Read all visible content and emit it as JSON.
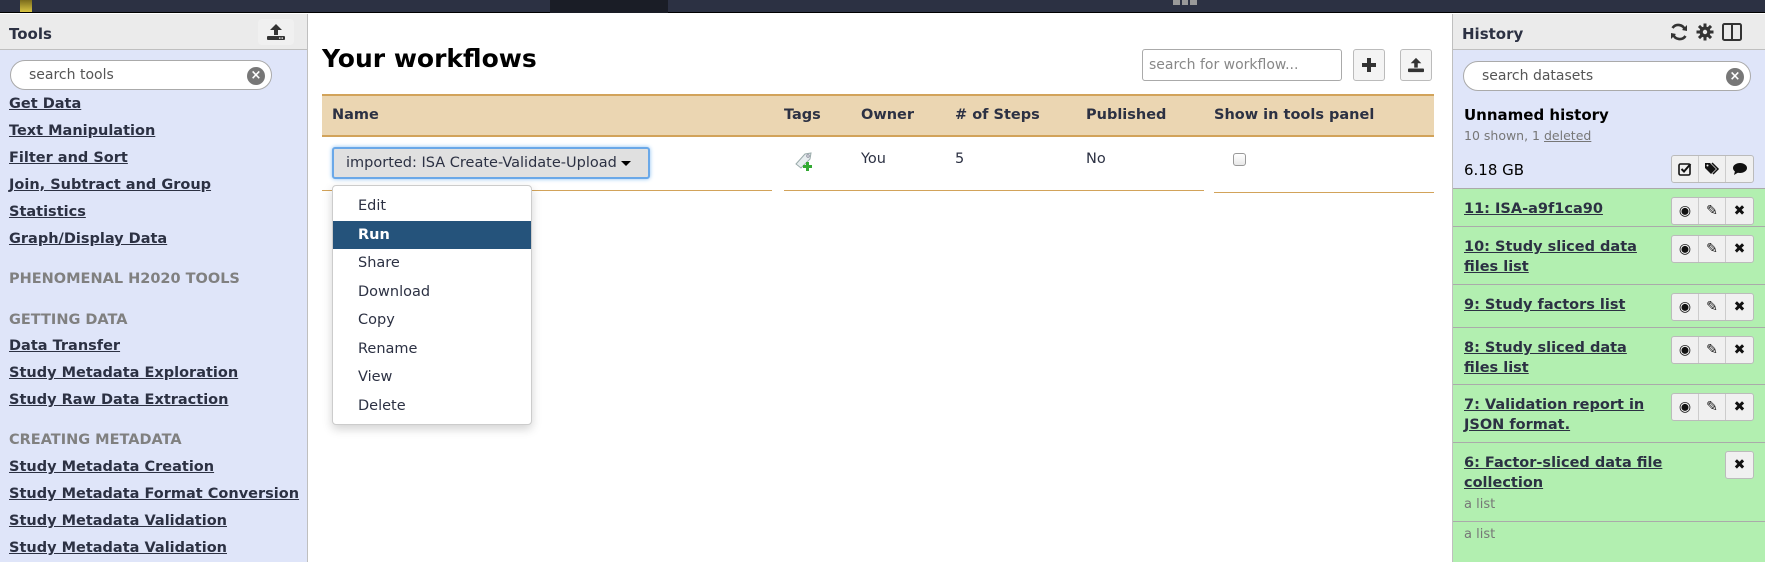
{
  "tool_panel": {
    "title": "Tools",
    "search_placeholder": "search tools",
    "links": [
      "Get Data",
      "Text Manipulation",
      "Filter and Sort",
      "Join, Subtract and Group",
      "Statistics",
      "Graph/Display Data"
    ],
    "sections": [
      {
        "label": "PHENOMENAL H2020 TOOLS",
        "items": []
      },
      {
        "label": "GETTING DATA",
        "items": [
          "Data Transfer",
          "Study Metadata Exploration",
          "Study Raw Data Extraction"
        ]
      },
      {
        "label": "CREATING METADATA",
        "items": [
          "Study Metadata Creation",
          "Study Metadata Format Conversion",
          "Study Metadata Validation",
          "Study Metadata Validation"
        ]
      }
    ]
  },
  "workflows": {
    "title": "Your workflows",
    "search_placeholder": "search for workflow...",
    "create_icon": "plus-icon",
    "import_icon": "upload-icon",
    "columns": [
      "Name",
      "Tags",
      "Owner",
      "# of Steps",
      "Published",
      "Show in tools panel"
    ],
    "rows": [
      {
        "name": "imported: ISA Create-Validate-Upload",
        "tags_icon": "add-tag-icon",
        "owner": "You",
        "steps": "5",
        "published": "No",
        "show_in_tools": false
      }
    ],
    "menu": {
      "items": [
        "Edit",
        "Run",
        "Share",
        "Download",
        "Copy",
        "Rename",
        "View",
        "Delete"
      ],
      "active": "Run"
    }
  },
  "history": {
    "title": "History",
    "header_icons": [
      "refresh-icon",
      "gear-icon",
      "columns-icon"
    ],
    "search_placeholder": "search datasets",
    "name": "Unnamed history",
    "shown": "10 shown, 1",
    "deleted_link": "deleted",
    "size": "6.18 GB",
    "action_icons": [
      "select-icon",
      "tags-icon",
      "comment-icon"
    ],
    "datasets": [
      {
        "title": "11: ISA-a9f1ca90 ",
        "state": "ok",
        "buttons": [
          "eye-icon",
          "pencil-icon",
          "delete-icon"
        ]
      },
      {
        "title": "10: Study sliced data files list ",
        "state": "ok",
        "buttons": [
          "eye-icon",
          "pencil-icon",
          "delete-icon"
        ]
      },
      {
        "title": "9: Study factors list ",
        "state": "ok",
        "buttons": [
          "eye-icon",
          "pencil-icon",
          "delete-icon"
        ]
      },
      {
        "title": "8: Study sliced data files list ",
        "state": "ok",
        "buttons": [
          "eye-icon",
          "pencil-icon",
          "delete-icon"
        ]
      },
      {
        "title": "7: Validation report in JSON format. ",
        "state": "ok",
        "buttons": [
          "eye-icon",
          "pencil-icon",
          "delete-icon"
        ]
      },
      {
        "title": "6: Factor-sliced data file collection",
        "subtitle": "a list",
        "state": "ok",
        "buttons": [
          "delete-icon"
        ]
      },
      {
        "title": "",
        "subtitle": "a list",
        "state": "ok",
        "buttons": []
      }
    ]
  },
  "colors": {
    "masthead": "#2c3143",
    "panel_bg": "#dfe5f9",
    "table_header": "#ebd6b2",
    "table_border": "#d2a35a",
    "menu_active": "#25537b",
    "dataset_ok": "#b2efb0"
  }
}
